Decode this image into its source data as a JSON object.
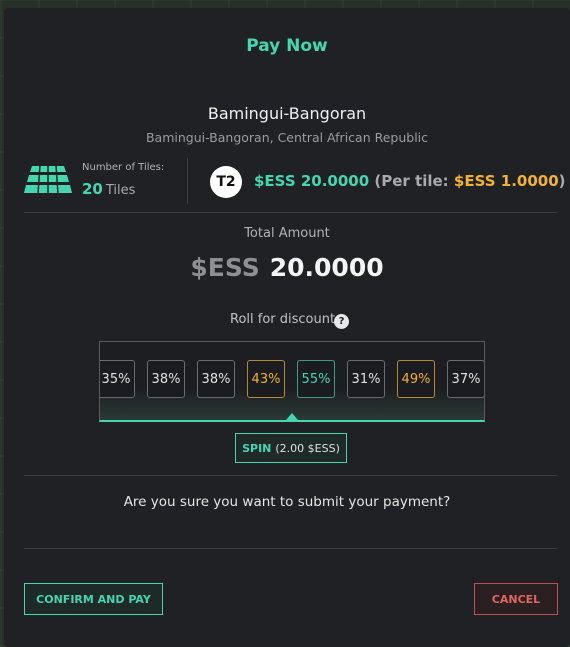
{
  "dialog": {
    "title": "Pay Now",
    "region_name": "Bamingui-Bangoran",
    "region_location": "Bamingui-Bangoran, Central African Republic"
  },
  "tiles": {
    "label": "Number of Tiles:",
    "count": "20",
    "unit": "Tiles",
    "icon": "tiles-stack-icon"
  },
  "pricing": {
    "tier_badge": "T2",
    "price": "$ESS 20.0000",
    "per_tile_prefix": "(Per tile:",
    "per_tile_value": "$ESS 1.0000",
    "per_tile_suffix": ")"
  },
  "total": {
    "label": "Total Amount",
    "currency": "$ESS",
    "amount": "20.0000"
  },
  "discount": {
    "label": "Roll for discount",
    "help_icon": "?",
    "rolls": [
      {
        "value": "35%",
        "color": "neutral"
      },
      {
        "value": "38%",
        "color": "neutral"
      },
      {
        "value": "38%",
        "color": "neutral"
      },
      {
        "value": "43%",
        "color": "orange"
      },
      {
        "value": "55%",
        "color": "green"
      },
      {
        "value": "31%",
        "color": "neutral"
      },
      {
        "value": "49%",
        "color": "orange"
      },
      {
        "value": "37%",
        "color": "neutral"
      }
    ],
    "spin_label": "SPIN",
    "spin_cost": "(2.00 $ESS)"
  },
  "confirmation": {
    "question": "Are you sure you want to submit your payment?",
    "confirm_label": "CONFIRM AND PAY",
    "cancel_label": "CANCEL"
  },
  "colors": {
    "accent": "#45d6b0",
    "warning": "#f2b233",
    "danger": "#e0655f",
    "panel": "#202124"
  }
}
